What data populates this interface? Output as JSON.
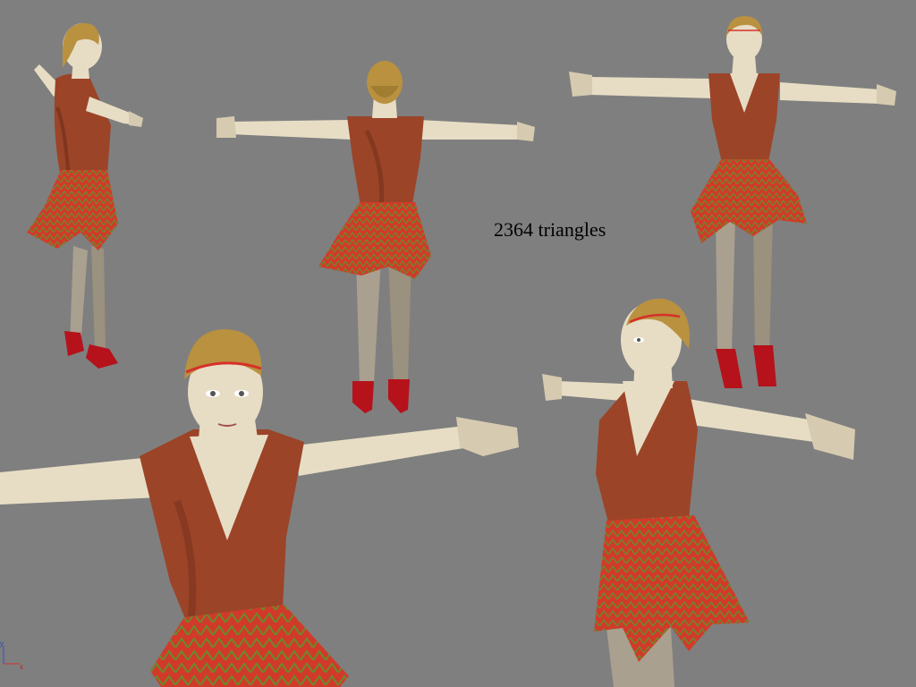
{
  "caption": "2364 triangles",
  "axis_gizmo": {
    "x_label": "x",
    "y_label": "y"
  },
  "colors": {
    "background": "#7f7f7f",
    "skin": "#e7ddc5",
    "skin_shade": "#c9bca0",
    "hair": "#b9913f",
    "hair_shade": "#8a6a26",
    "bodice": "#9b4428",
    "bodice_shade": "#6e2c18",
    "skirt": "#d13a2a",
    "skirt_shade": "#8c1f14",
    "skirt_pattern": "#6a8a2a",
    "stockings": "#a9a08f",
    "shoes": "#b5121b",
    "headband": "#d6302a"
  },
  "views": [
    {
      "name": "three-quarter back-left"
    },
    {
      "name": "back"
    },
    {
      "name": "front"
    },
    {
      "name": "close-up front"
    },
    {
      "name": "three-quarter front close-up"
    }
  ]
}
